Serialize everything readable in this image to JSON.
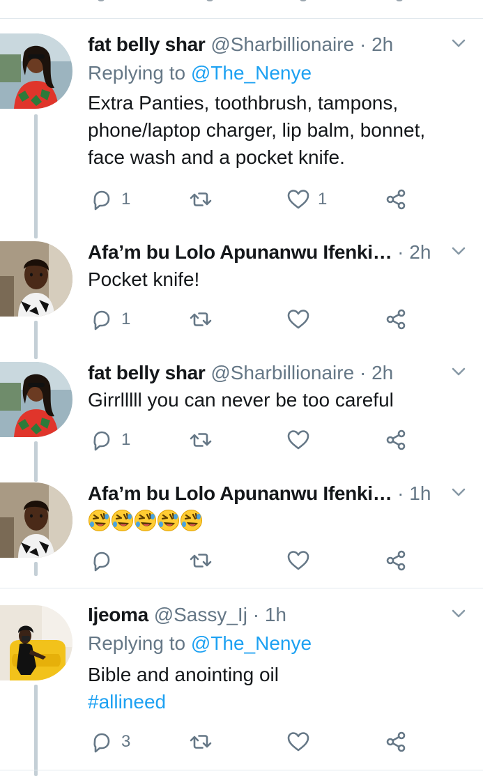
{
  "tweets": [
    {
      "name": "fat belly shar",
      "handle": "@Sharbillionaire",
      "time": "2h",
      "replying_label": "Replying to",
      "replying_handle": "@The_Nenye",
      "lines": [
        "Extra Panties, toothbrush, tampons,",
        "phone/laptop charger, lip balm, bonnet,",
        "face wash and a pocket knife."
      ],
      "reply_count": "1",
      "retweet_count": "",
      "like_count": "1"
    },
    {
      "name": "Afa’m bu Lolo Apunanwu Ifenki…",
      "handle": "",
      "time": "2h",
      "lines": [
        "Pocket knife!"
      ],
      "reply_count": "1",
      "retweet_count": "",
      "like_count": ""
    },
    {
      "name": "fat belly shar",
      "handle": "@Sharbillionaire",
      "time": "2h",
      "lines": [
        "Girrlllll you can never be too careful"
      ],
      "reply_count": "1",
      "retweet_count": "",
      "like_count": ""
    },
    {
      "name": "Afa’m bu Lolo Apunanwu Ifenki…",
      "handle": "",
      "time": "1h",
      "emoji": [
        "rolling-on-floor-laughing",
        "rolling-on-floor-laughing",
        "rolling-on-floor-laughing",
        "rolling-on-floor-laughing",
        "rolling-on-floor-laughing"
      ],
      "reply_count": "",
      "retweet_count": "",
      "like_count": ""
    },
    {
      "name": "Ijeoma",
      "handle": "@Sassy_Ij",
      "time": "1h",
      "replying_label": "Replying to",
      "replying_handle": "@The_Nenye",
      "lines": [
        "Bible and anointing oil"
      ],
      "hashtag": "#allineed",
      "reply_count": "3",
      "retweet_count": "",
      "like_count": ""
    }
  ],
  "colors": {
    "text": "#14171a",
    "secondary": "#657786",
    "link": "#1da1f2",
    "thread_line": "#c4cfd6",
    "divider": "#e1e8ed"
  },
  "icons": {
    "reply": "speech-bubble-icon",
    "retweet": "retweet-arrows-icon",
    "like": "heart-outline-icon",
    "share": "share-nodes-icon",
    "more": "chevron-down-icon"
  }
}
